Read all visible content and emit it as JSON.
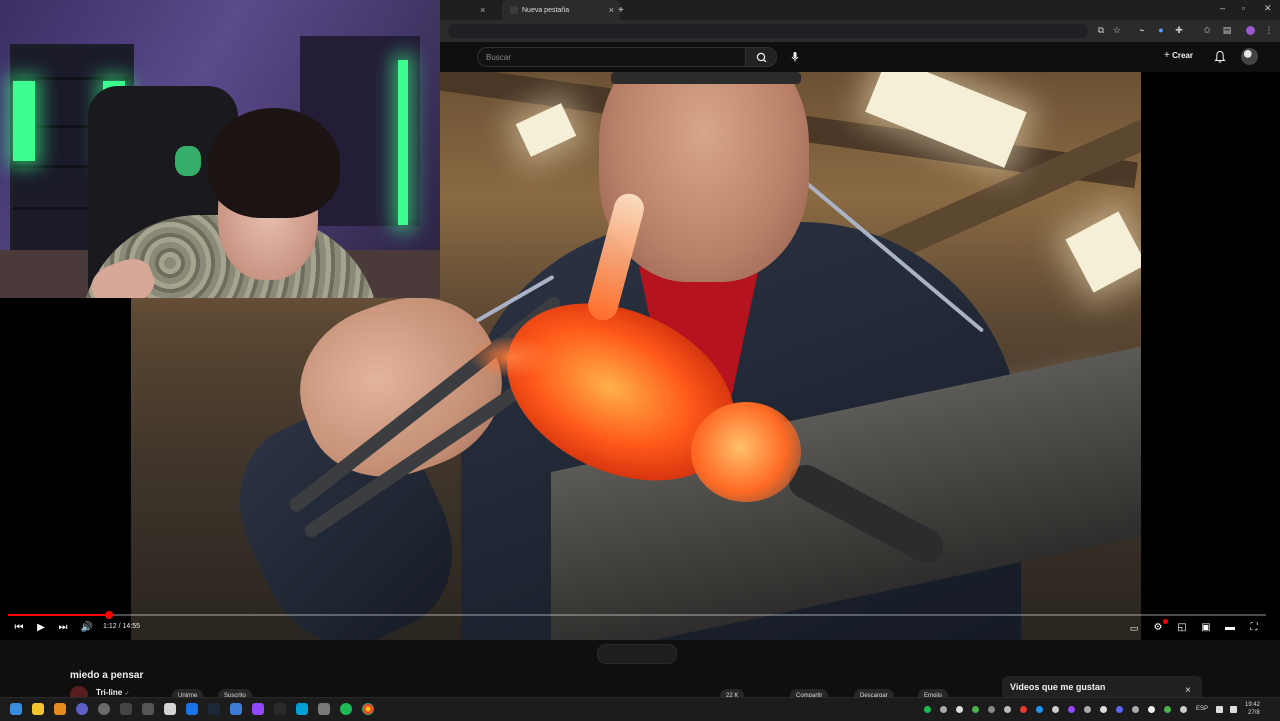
{
  "browser": {
    "tabs": [
      {
        "label": "",
        "close": "×"
      },
      {
        "label": "Nueva pestaña",
        "close": "×"
      }
    ],
    "new_tab": "+",
    "window_controls": {
      "minimize": "–",
      "maximize": "▫",
      "close": "✕"
    }
  },
  "youtube": {
    "search": {
      "placeholder": "Buscar",
      "value": ""
    },
    "create_label": "Crear"
  },
  "player": {
    "current_time": "1:12",
    "duration": "14:55",
    "time_display": "1:12 / 14:55",
    "progress": 0.08
  },
  "video": {
    "title": "miedo a pensar",
    "channel": "Tri-line",
    "verified_icon": "✓",
    "action_pills": [
      "Unirme",
      "Suscrito",
      "22 K",
      "Compartir",
      "Descargar",
      "Emojis"
    ]
  },
  "side_panel": {
    "title": "Videos que me gustan",
    "close": "×"
  },
  "taskbar": {
    "language": "ESP",
    "time": "19:42",
    "date": "27/8"
  },
  "colors": {
    "youtube_red": "#ff0000",
    "background": "#0f0f0f",
    "glass_orange": "#ff5a1a",
    "led_green": "#3cff8f"
  }
}
